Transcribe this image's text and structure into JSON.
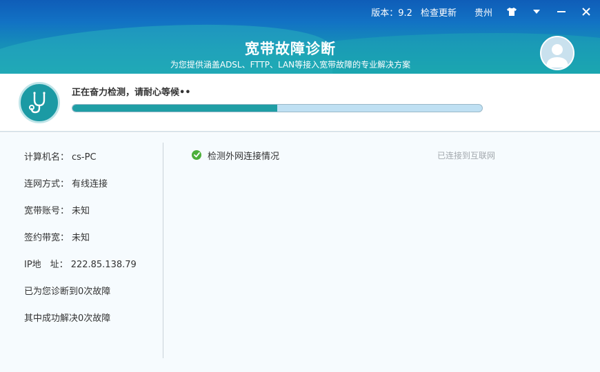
{
  "topbar": {
    "version_label": "版本：9.2",
    "check_update": "检查更新",
    "region": "贵州",
    "icons": [
      "shirt-icon",
      "dropdown-icon",
      "minimize-icon",
      "close-icon"
    ]
  },
  "header": {
    "title": "宽带故障诊断",
    "subtitle": "为您提供涵盖ADSL、FTTP、LAN等接入宽带故障的专业解决方案"
  },
  "progress": {
    "status_text": "正在奋力检测，请耐心等候••",
    "fraction": 0.5
  },
  "info": {
    "computer_label": "计算机名：",
    "computer_value": "cs-PC",
    "connection_label": "连网方式：",
    "connection_value": "有线连接",
    "account_label": "宽带账号：",
    "account_value": "未知",
    "bandwidth_label": "签约带宽：",
    "bandwidth_value": "未知",
    "ip_label": "IP地　址：",
    "ip_value": "222.85.138.79",
    "diagnosed_text": "已为您诊断到0次故障",
    "solved_text": "其中成功解决0次故障"
  },
  "checks": [
    {
      "label": "检测外网连接情况",
      "result": "已连接到互联网",
      "status": "passed"
    }
  ],
  "colors": {
    "accent": "#1f9ea5",
    "progress_track": "#bfe0f3",
    "check_green": "#4caf3a"
  }
}
